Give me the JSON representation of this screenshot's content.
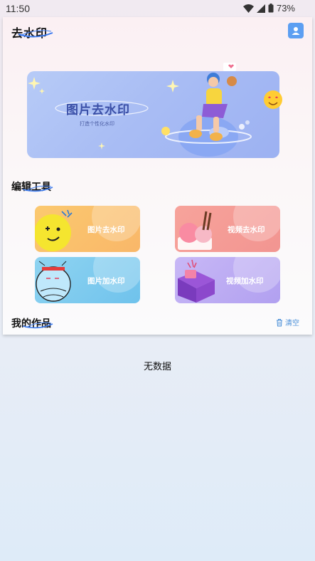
{
  "status": {
    "time": "11:50",
    "battery": "73%"
  },
  "header": {
    "title": "去水印",
    "avatar_icon": "user-icon"
  },
  "banner": {
    "title": "图片去水印",
    "subtitle": "打造个性化水印"
  },
  "tools_section": {
    "title": "编辑工具"
  },
  "tools": [
    {
      "label": "图片去水印",
      "color": "#fbc96f"
    },
    {
      "label": "视频去水印",
      "color": "#f7a39b"
    },
    {
      "label": "图片加水印",
      "color": "#8fd4f1"
    },
    {
      "label": "视频加水印",
      "color": "#c8b8f6"
    }
  ],
  "works_section": {
    "title": "我的作品",
    "clear_label": "清空",
    "empty_text": "无数据"
  },
  "colors": {
    "accent": "#4a8fd8",
    "banner_title": "#3a4fa7"
  }
}
